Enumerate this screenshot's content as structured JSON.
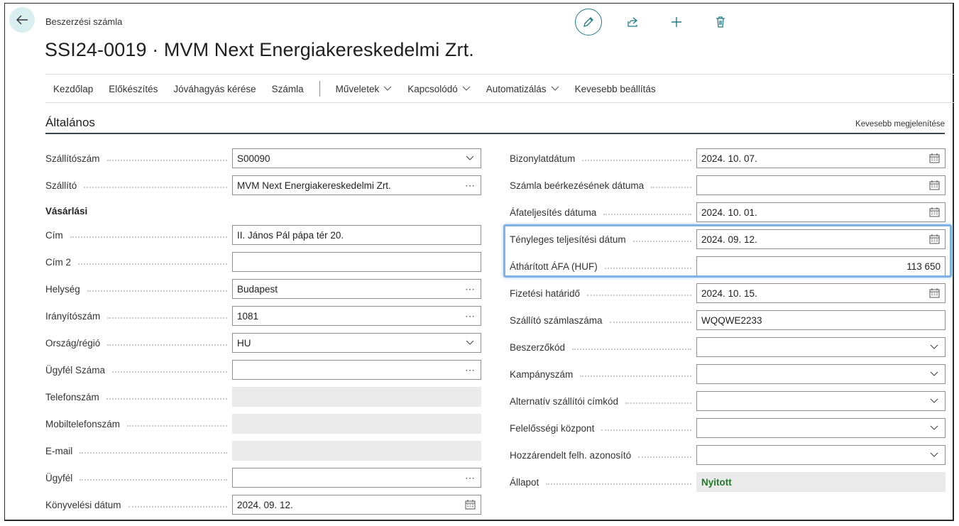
{
  "header": {
    "caption": "Beszerzési számla",
    "title": "SSI24-0019 · MVM Next Energiakereskedelmi Zrt."
  },
  "toolbar_icons": [
    "pencil-icon",
    "share-icon",
    "plus-icon",
    "trash-icon"
  ],
  "action_bar": {
    "items": [
      {
        "label": "Kezdőlap"
      },
      {
        "label": "Előkészítés"
      },
      {
        "label": "Jóváhagyás kérése"
      },
      {
        "label": "Számla"
      },
      {
        "label": "Műveletek",
        "dropdown": true
      },
      {
        "label": "Kapcsolódó",
        "dropdown": true
      },
      {
        "label": "Automatizálás",
        "dropdown": true
      },
      {
        "label": "Kevesebb beállítás"
      }
    ]
  },
  "section": {
    "title": "Általános",
    "show_less": "Kevesebb megjelenítése",
    "subheading": "Vásárlási"
  },
  "left_fields": [
    {
      "label": "Szállítószám",
      "value": "S00090",
      "control": "dropdown"
    },
    {
      "label": "Szállító",
      "value": "MVM Next Energiakereskedelmi Zrt.",
      "control": "lookup"
    },
    {
      "label": "Cím",
      "value": "II. János Pál pápa tér 20.",
      "control": "text"
    },
    {
      "label": "Cím 2",
      "value": "",
      "control": "text"
    },
    {
      "label": "Helység",
      "value": "Budapest",
      "control": "lookup"
    },
    {
      "label": "Irányítószám",
      "value": "1081",
      "control": "lookup"
    },
    {
      "label": "Ország/régió",
      "value": "HU",
      "control": "dropdown"
    },
    {
      "label": "Ügyfél Száma",
      "value": "",
      "control": "lookup"
    },
    {
      "label": "Telefonszám",
      "value": "",
      "control": "readonly"
    },
    {
      "label": "Mobiltelefonszám",
      "value": "",
      "control": "readonly"
    },
    {
      "label": "E-mail",
      "value": "",
      "control": "readonly"
    },
    {
      "label": "Ügyfél",
      "value": "",
      "control": "lookup"
    },
    {
      "label": "Könyvelési dátum",
      "value": "2024. 09. 12.",
      "control": "date"
    }
  ],
  "right_fields": [
    {
      "label": "Bizonylatdátum",
      "value": "2024. 10. 07.",
      "control": "date"
    },
    {
      "label": "Számla beérkezésének dátuma",
      "value": "",
      "control": "date"
    },
    {
      "label": "Áfateljesítés dátuma",
      "value": "2024. 10. 01.",
      "control": "date"
    },
    {
      "label": "Tényleges teljesítési dátum",
      "value": "2024. 09. 12.",
      "control": "date"
    },
    {
      "label": "Áthárított ÁFA (HUF)",
      "value": "113 650",
      "control": "number"
    },
    {
      "label": "Fizetési határidő",
      "value": "2024. 10. 15.",
      "control": "date"
    },
    {
      "label": "Szállító számlaszáma",
      "value": "WQQWE2233",
      "control": "text"
    },
    {
      "label": "Beszerzőkód",
      "value": "",
      "control": "dropdown"
    },
    {
      "label": "Kampányszám",
      "value": "",
      "control": "dropdown"
    },
    {
      "label": "Alternatív szállítói címkód",
      "value": "",
      "control": "dropdown"
    },
    {
      "label": "Felelősségi központ",
      "value": "",
      "control": "dropdown"
    },
    {
      "label": "Hozzárendelt felh. azonosító",
      "value": "",
      "control": "dropdown"
    },
    {
      "label": "Állapot",
      "value": "Nyitott",
      "control": "status"
    }
  ],
  "colors": {
    "accent": "#1f7a87",
    "status_open": "#237a27",
    "highlight": "#7fb2e6"
  }
}
